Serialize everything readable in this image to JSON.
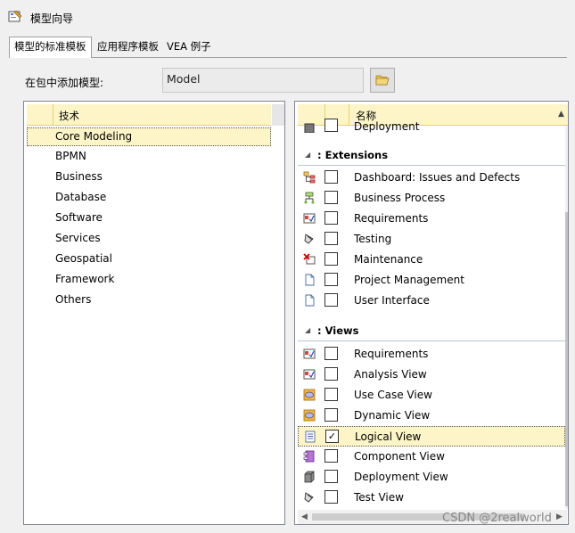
{
  "window": {
    "title": "模型向导"
  },
  "tabs": [
    {
      "label": "模型的标准模板",
      "active": true
    },
    {
      "label": "应用程序模板",
      "active": false
    },
    {
      "label": "VEA 例子",
      "active": false
    }
  ],
  "package": {
    "label": "在包中添加模型:",
    "value": "Model"
  },
  "technology": {
    "header": "技术",
    "items": [
      "Core Modeling",
      "BPMN",
      "Business",
      "Database",
      "Software",
      "Services",
      "Geospatial",
      "Framework",
      "Others"
    ],
    "selected": "Core Modeling"
  },
  "models": {
    "header": "名称",
    "partial_row": "Deployment",
    "groups": [
      {
        "name": ": Extensions",
        "rows": [
          {
            "icon": "hierarchy-icon",
            "label": "Dashboard: Issues and Defects",
            "checked": false
          },
          {
            "icon": "process-icon",
            "label": "Business Process",
            "checked": false
          },
          {
            "icon": "requirements-icon",
            "label": "Requirements",
            "checked": false
          },
          {
            "icon": "test-icon",
            "label": "Testing",
            "checked": false
          },
          {
            "icon": "maintenance-icon",
            "label": "Maintenance",
            "checked": false
          },
          {
            "icon": "document-icon",
            "label": "Project Management",
            "checked": false
          },
          {
            "icon": "document-icon",
            "label": "User Interface",
            "checked": false
          }
        ]
      },
      {
        "name": ": Views",
        "rows": [
          {
            "icon": "requirements-icon",
            "label": "Requirements",
            "checked": false
          },
          {
            "icon": "requirements-icon",
            "label": "Analysis View",
            "checked": false
          },
          {
            "icon": "usecase-icon",
            "label": "Use Case View",
            "checked": false
          },
          {
            "icon": "usecase-icon",
            "label": "Dynamic View",
            "checked": false
          },
          {
            "icon": "logical-icon",
            "label": "Logical View",
            "checked": true
          },
          {
            "icon": "component-icon",
            "label": "Component View",
            "checked": false
          },
          {
            "icon": "deployment-icon",
            "label": "Deployment View",
            "checked": false
          },
          {
            "icon": "test-icon",
            "label": "Test View",
            "checked": false
          }
        ]
      }
    ]
  },
  "watermark": "CSDN @2realworld"
}
